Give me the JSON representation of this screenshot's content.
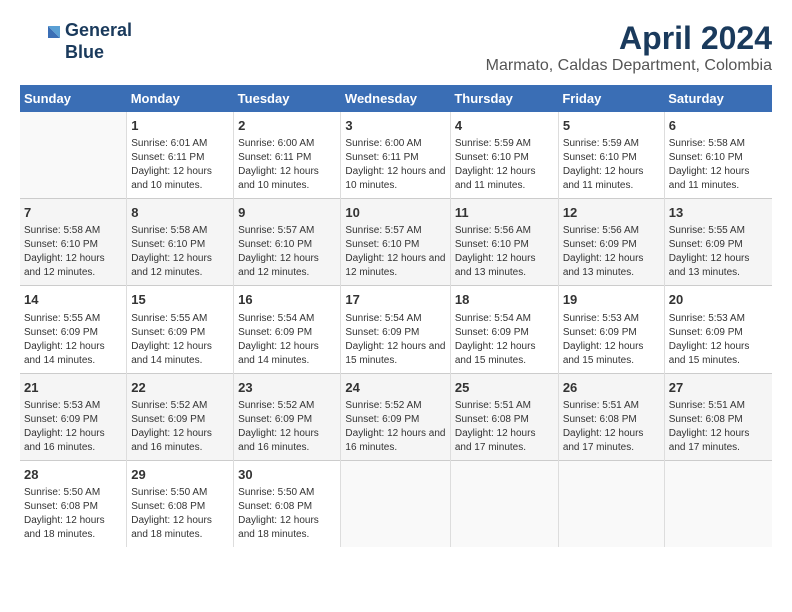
{
  "logo": {
    "line1": "General",
    "line2": "Blue"
  },
  "title": "April 2024",
  "location": "Marmato, Caldas Department, Colombia",
  "days_of_week": [
    "Sunday",
    "Monday",
    "Tuesday",
    "Wednesday",
    "Thursday",
    "Friday",
    "Saturday"
  ],
  "weeks": [
    [
      {
        "day": "",
        "sunrise": "",
        "sunset": "",
        "daylight": ""
      },
      {
        "day": "1",
        "sunrise": "Sunrise: 6:01 AM",
        "sunset": "Sunset: 6:11 PM",
        "daylight": "Daylight: 12 hours and 10 minutes."
      },
      {
        "day": "2",
        "sunrise": "Sunrise: 6:00 AM",
        "sunset": "Sunset: 6:11 PM",
        "daylight": "Daylight: 12 hours and 10 minutes."
      },
      {
        "day": "3",
        "sunrise": "Sunrise: 6:00 AM",
        "sunset": "Sunset: 6:11 PM",
        "daylight": "Daylight: 12 hours and 10 minutes."
      },
      {
        "day": "4",
        "sunrise": "Sunrise: 5:59 AM",
        "sunset": "Sunset: 6:10 PM",
        "daylight": "Daylight: 12 hours and 11 minutes."
      },
      {
        "day": "5",
        "sunrise": "Sunrise: 5:59 AM",
        "sunset": "Sunset: 6:10 PM",
        "daylight": "Daylight: 12 hours and 11 minutes."
      },
      {
        "day": "6",
        "sunrise": "Sunrise: 5:58 AM",
        "sunset": "Sunset: 6:10 PM",
        "daylight": "Daylight: 12 hours and 11 minutes."
      }
    ],
    [
      {
        "day": "7",
        "sunrise": "Sunrise: 5:58 AM",
        "sunset": "Sunset: 6:10 PM",
        "daylight": "Daylight: 12 hours and 12 minutes."
      },
      {
        "day": "8",
        "sunrise": "Sunrise: 5:58 AM",
        "sunset": "Sunset: 6:10 PM",
        "daylight": "Daylight: 12 hours and 12 minutes."
      },
      {
        "day": "9",
        "sunrise": "Sunrise: 5:57 AM",
        "sunset": "Sunset: 6:10 PM",
        "daylight": "Daylight: 12 hours and 12 minutes."
      },
      {
        "day": "10",
        "sunrise": "Sunrise: 5:57 AM",
        "sunset": "Sunset: 6:10 PM",
        "daylight": "Daylight: 12 hours and 12 minutes."
      },
      {
        "day": "11",
        "sunrise": "Sunrise: 5:56 AM",
        "sunset": "Sunset: 6:10 PM",
        "daylight": "Daylight: 12 hours and 13 minutes."
      },
      {
        "day": "12",
        "sunrise": "Sunrise: 5:56 AM",
        "sunset": "Sunset: 6:09 PM",
        "daylight": "Daylight: 12 hours and 13 minutes."
      },
      {
        "day": "13",
        "sunrise": "Sunrise: 5:55 AM",
        "sunset": "Sunset: 6:09 PM",
        "daylight": "Daylight: 12 hours and 13 minutes."
      }
    ],
    [
      {
        "day": "14",
        "sunrise": "Sunrise: 5:55 AM",
        "sunset": "Sunset: 6:09 PM",
        "daylight": "Daylight: 12 hours and 14 minutes."
      },
      {
        "day": "15",
        "sunrise": "Sunrise: 5:55 AM",
        "sunset": "Sunset: 6:09 PM",
        "daylight": "Daylight: 12 hours and 14 minutes."
      },
      {
        "day": "16",
        "sunrise": "Sunrise: 5:54 AM",
        "sunset": "Sunset: 6:09 PM",
        "daylight": "Daylight: 12 hours and 14 minutes."
      },
      {
        "day": "17",
        "sunrise": "Sunrise: 5:54 AM",
        "sunset": "Sunset: 6:09 PM",
        "daylight": "Daylight: 12 hours and 15 minutes."
      },
      {
        "day": "18",
        "sunrise": "Sunrise: 5:54 AM",
        "sunset": "Sunset: 6:09 PM",
        "daylight": "Daylight: 12 hours and 15 minutes."
      },
      {
        "day": "19",
        "sunrise": "Sunrise: 5:53 AM",
        "sunset": "Sunset: 6:09 PM",
        "daylight": "Daylight: 12 hours and 15 minutes."
      },
      {
        "day": "20",
        "sunrise": "Sunrise: 5:53 AM",
        "sunset": "Sunset: 6:09 PM",
        "daylight": "Daylight: 12 hours and 15 minutes."
      }
    ],
    [
      {
        "day": "21",
        "sunrise": "Sunrise: 5:53 AM",
        "sunset": "Sunset: 6:09 PM",
        "daylight": "Daylight: 12 hours and 16 minutes."
      },
      {
        "day": "22",
        "sunrise": "Sunrise: 5:52 AM",
        "sunset": "Sunset: 6:09 PM",
        "daylight": "Daylight: 12 hours and 16 minutes."
      },
      {
        "day": "23",
        "sunrise": "Sunrise: 5:52 AM",
        "sunset": "Sunset: 6:09 PM",
        "daylight": "Daylight: 12 hours and 16 minutes."
      },
      {
        "day": "24",
        "sunrise": "Sunrise: 5:52 AM",
        "sunset": "Sunset: 6:09 PM",
        "daylight": "Daylight: 12 hours and 16 minutes."
      },
      {
        "day": "25",
        "sunrise": "Sunrise: 5:51 AM",
        "sunset": "Sunset: 6:08 PM",
        "daylight": "Daylight: 12 hours and 17 minutes."
      },
      {
        "day": "26",
        "sunrise": "Sunrise: 5:51 AM",
        "sunset": "Sunset: 6:08 PM",
        "daylight": "Daylight: 12 hours and 17 minutes."
      },
      {
        "day": "27",
        "sunrise": "Sunrise: 5:51 AM",
        "sunset": "Sunset: 6:08 PM",
        "daylight": "Daylight: 12 hours and 17 minutes."
      }
    ],
    [
      {
        "day": "28",
        "sunrise": "Sunrise: 5:50 AM",
        "sunset": "Sunset: 6:08 PM",
        "daylight": "Daylight: 12 hours and 18 minutes."
      },
      {
        "day": "29",
        "sunrise": "Sunrise: 5:50 AM",
        "sunset": "Sunset: 6:08 PM",
        "daylight": "Daylight: 12 hours and 18 minutes."
      },
      {
        "day": "30",
        "sunrise": "Sunrise: 5:50 AM",
        "sunset": "Sunset: 6:08 PM",
        "daylight": "Daylight: 12 hours and 18 minutes."
      },
      {
        "day": "",
        "sunrise": "",
        "sunset": "",
        "daylight": ""
      },
      {
        "day": "",
        "sunrise": "",
        "sunset": "",
        "daylight": ""
      },
      {
        "day": "",
        "sunrise": "",
        "sunset": "",
        "daylight": ""
      },
      {
        "day": "",
        "sunrise": "",
        "sunset": "",
        "daylight": ""
      }
    ]
  ]
}
